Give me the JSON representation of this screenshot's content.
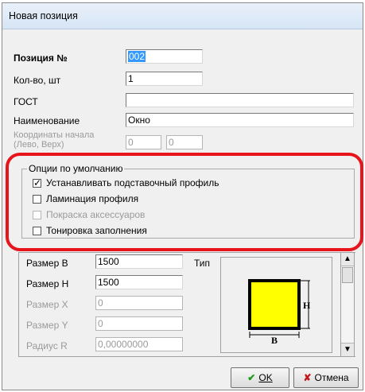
{
  "window": {
    "title": "Новая позиция"
  },
  "fields": {
    "position": {
      "label": "Позиция №",
      "value": "002"
    },
    "qty": {
      "label": "Кол-во, шт",
      "value": "1"
    },
    "gost": {
      "label": "ГОСТ",
      "value": ""
    },
    "name": {
      "label": "Наименование",
      "value": "Окно"
    },
    "coords": {
      "label_line1": "Координаты начала",
      "label_line2": "(Лево, Верх)",
      "x": "0",
      "y": "0"
    }
  },
  "options": {
    "title": "Опции по умолчанию",
    "items": [
      {
        "label": "Устанавливать подставочный профиль",
        "checked": true,
        "enabled": true
      },
      {
        "label": "Ламинация профиля",
        "checked": false,
        "enabled": true
      },
      {
        "label": "Покраска аксессуаров",
        "checked": false,
        "enabled": false
      },
      {
        "label": "Тонировка заполнения",
        "checked": false,
        "enabled": true
      }
    ]
  },
  "size": {
    "width": {
      "label": "Размер B",
      "value": "1500"
    },
    "height": {
      "label": "Размер H",
      "value": "1500"
    },
    "x": {
      "label": "Размер X",
      "value": "0"
    },
    "y": {
      "label": "Размер Y",
      "value": "0"
    },
    "radius": {
      "label": "Радиус R",
      "value": "0,00000000"
    },
    "type_label": "Тип"
  },
  "preview": {
    "h_label": "H",
    "b_label": "B",
    "fill_color": "#ffff00"
  },
  "buttons": {
    "ok": "OK",
    "cancel": "Отмена"
  },
  "colors": {
    "highlight": "#e8141c",
    "selection": "#3399ff"
  }
}
